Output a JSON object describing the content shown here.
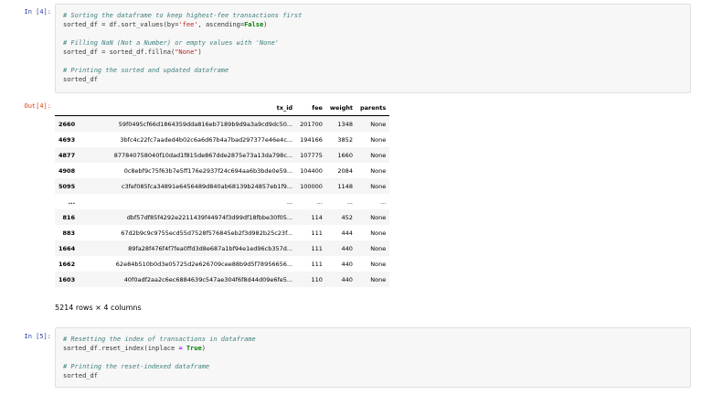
{
  "cells": {
    "in4": {
      "prompt": "In [4]:",
      "c1": "# Sorting the dataframe to keep highest-fee transactions first",
      "l2a": "sorted_df = df.sort_values(by=",
      "l2str": "'fee'",
      "l2b": ", ascending=",
      "l2kw": "False",
      "l2c": ")",
      "c2": "# Filling NaN (Not a Number) or empty values with 'None'",
      "l4a": "sorted_df = sorted_df.fillna(",
      "l4str": "\"None\"",
      "l4b": ")",
      "c3": "# Printing the sorted and updated dataframe",
      "l6": "sorted_df"
    },
    "out4": {
      "prompt": "Out[4]:"
    },
    "in5": {
      "prompt": "In [5]:",
      "c1": "# Resetting the index of transactions in dataframe",
      "l2a": "sorted_df.reset_index(inplace ",
      "l2op": "=",
      "l2b": " ",
      "l2kw": "True",
      "l2c": ")",
      "c2": "# Printing the reset-indexed dataframe",
      "l5": "sorted_df"
    }
  },
  "dataframe": {
    "columns": [
      "",
      "tx_id",
      "fee",
      "weight",
      "parents"
    ],
    "rows": [
      [
        "2660",
        "59f0495cf66d1864359dda816eb7189b9d9a3a9cd9dc50...",
        "201700",
        "1348",
        "None"
      ],
      [
        "4693",
        "3bfc4c22fc7aaded4b02c6a6d67b4a7bad297377e46e4c...",
        "194166",
        "3852",
        "None"
      ],
      [
        "4877",
        "877840758040f10dad1f815de867dde2875e73a13da798c...",
        "107775",
        "1660",
        "None"
      ],
      [
        "4908",
        "0c8ebf9c75f63b7e5ff176e2937f24c694aa6b3bde0e59...",
        "104400",
        "2084",
        "None"
      ],
      [
        "5095",
        "c3fef085fca34891e6456489d840ab68139b24857eb1f9...",
        "100000",
        "1148",
        "None"
      ],
      [
        "...",
        "...",
        "...",
        "...",
        "..."
      ],
      [
        "816",
        "dbf57df85f4292e2211439f44974f3d99df18fbbe30f05...",
        "114",
        "452",
        "None"
      ],
      [
        "883",
        "67d2b9c9c9755ecd55d7528f576845eb2f3d982b25c23f...",
        "111",
        "444",
        "None"
      ],
      [
        "1664",
        "89fa28f476f4f7fea0ffd3d8e687a1bf94e1ed96cb357d...",
        "111",
        "440",
        "None"
      ],
      [
        "1662",
        "62e84b510b0d3e05725d2e626709cee88b9d5f78956656...",
        "111",
        "440",
        "None"
      ],
      [
        "1603",
        "40f0adf2aa2c6ec6884639c547ae304f6f8d44d09e6fe5...",
        "110",
        "440",
        "None"
      ]
    ],
    "shape": "5214 rows × 4 columns"
  }
}
